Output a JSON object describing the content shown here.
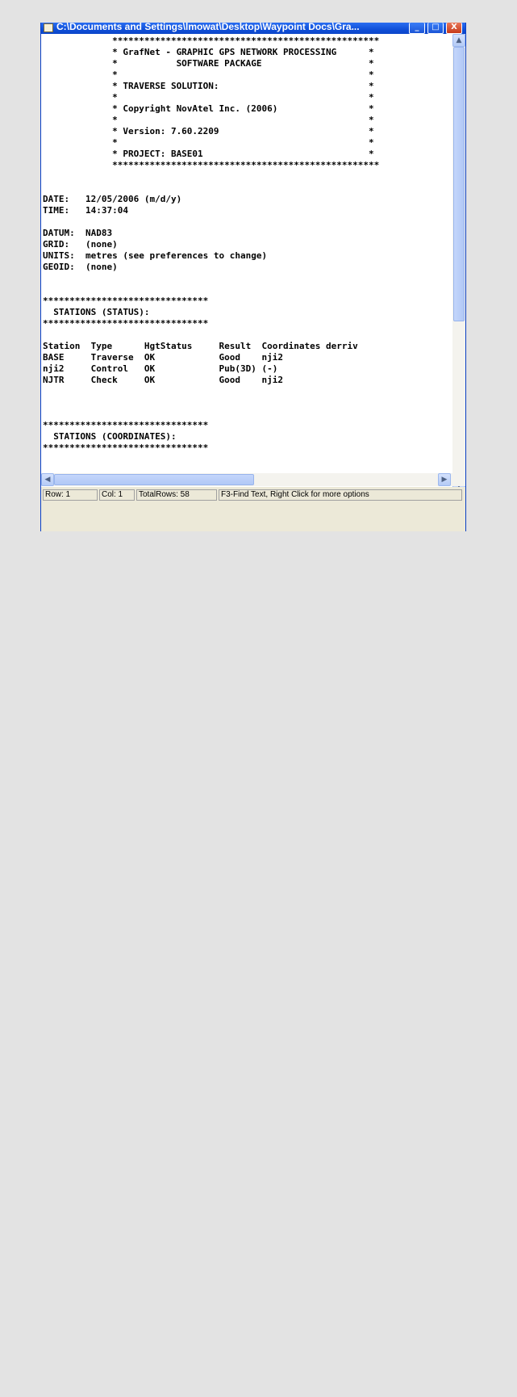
{
  "window": {
    "title": "C:\\Documents and Settings\\lmowat\\Desktop\\Waypoint Docs\\Gra...",
    "buttons": {
      "minimize": "_",
      "maximize": "□",
      "close": "X"
    }
  },
  "report_lines": [
    "             **************************************************",
    "             * GrafNet - GRAPHIC GPS NETWORK PROCESSING      *",
    "             *           SOFTWARE PACKAGE                    *",
    "             *                                               *",
    "             * TRAVERSE SOLUTION:                            *",
    "             *                                               *",
    "             * Copyright NovAtel Inc. (2006)                 *",
    "             *                                               *",
    "             * Version: 7.60.2209                            *",
    "             *                                               *",
    "             * PROJECT: BASE01                               *",
    "             **************************************************",
    "",
    "",
    "DATE:   12/05/2006 (m/d/y)",
    "TIME:   14:37:04",
    "",
    "DATUM:  NAD83",
    "GRID:   (none)",
    "UNITS:  metres (see preferences to change)",
    "GEOID:  (none)",
    "",
    "",
    "*******************************",
    "  STATIONS (STATUS):",
    "*******************************",
    "",
    "Station  Type      HgtStatus     Result  Coordinates derriv",
    "BASE     Traverse  OK            Good    nji2",
    "nji2     Control   OK            Pub(3D) (-)",
    "NJTR     Check     OK            Good    nji2",
    "",
    "",
    "",
    "*******************************",
    "  STATIONS (COORDINATES):",
    "*******************************"
  ],
  "status_bar": {
    "row": "Row: 1",
    "col": "Col: 1",
    "total_rows": "TotalRows: 58",
    "hint": "F3-Find Text, Right Click for more options"
  },
  "icons": {
    "scroll_up": "▲",
    "scroll_down": "▼",
    "scroll_left": "◀",
    "scroll_right": "▶"
  }
}
